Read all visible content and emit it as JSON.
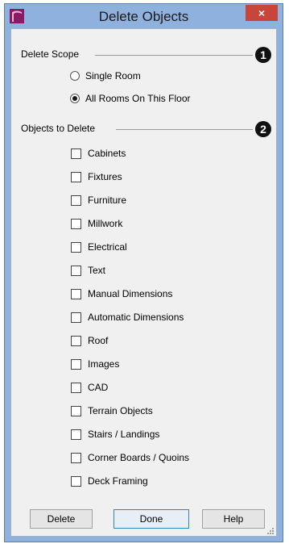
{
  "window": {
    "title": "Delete Objects",
    "close_label": "×"
  },
  "delete_scope": {
    "header": "Delete Scope",
    "callout": "1",
    "options": [
      {
        "label": "Single Room",
        "selected": false
      },
      {
        "label": "All Rooms On This Floor",
        "selected": true
      }
    ]
  },
  "objects_to_delete": {
    "header": "Objects to Delete",
    "callout": "2",
    "items": [
      {
        "label": "Cabinets",
        "checked": false
      },
      {
        "label": "Fixtures",
        "checked": false
      },
      {
        "label": "Furniture",
        "checked": false
      },
      {
        "label": "Millwork",
        "checked": false
      },
      {
        "label": "Electrical",
        "checked": false
      },
      {
        "label": "Text",
        "checked": false
      },
      {
        "label": "Manual Dimensions",
        "checked": false
      },
      {
        "label": "Automatic Dimensions",
        "checked": false
      },
      {
        "label": "Roof",
        "checked": false
      },
      {
        "label": "Images",
        "checked": false
      },
      {
        "label": "CAD",
        "checked": false
      },
      {
        "label": "Terrain Objects",
        "checked": false
      },
      {
        "label": "Stairs / Landings",
        "checked": false
      },
      {
        "label": "Corner Boards / Quoins",
        "checked": false
      },
      {
        "label": "Deck Framing",
        "checked": false
      }
    ]
  },
  "buttons": {
    "delete": "Delete",
    "done": "Done",
    "help": "Help"
  },
  "colors": {
    "frame": "#8eb1de",
    "close": "#c7453a",
    "app_icon": "#8a1a63"
  }
}
